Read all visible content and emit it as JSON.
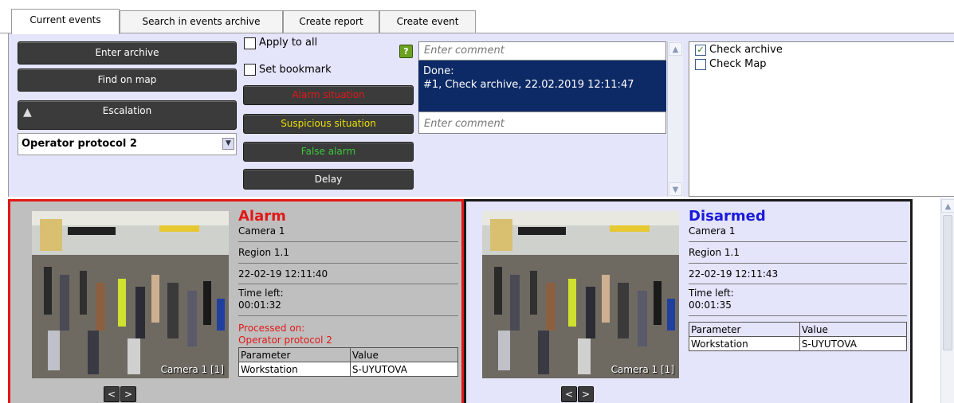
{
  "tabs": [
    {
      "label": "Current events",
      "active": true
    },
    {
      "label": "Search in events archive",
      "active": false
    },
    {
      "label": "Create report",
      "active": false
    },
    {
      "label": "Create event",
      "active": false
    }
  ],
  "controls": {
    "enter_archive": "Enter archive",
    "find_on_map": "Find on map",
    "escalation": "Escalation",
    "protocol_selected": "Operator protocol 2",
    "apply_to_all": "Apply to all",
    "set_bookmark": "Set bookmark",
    "help": "?",
    "alarm_situation": "Alarm situation",
    "suspicious_situation": "Suspicious situation",
    "false_alarm": "False alarm",
    "delay": "Delay"
  },
  "comments": {
    "top_placeholder": "Enter comment",
    "done_title": "Done:",
    "done_text": "#1, Check archive, 22.02.2019 12:11:47",
    "bottom_placeholder": "Enter comment"
  },
  "checklist": [
    {
      "label": "Check archive",
      "checked": true
    },
    {
      "label": "Check Map",
      "checked": false
    }
  ],
  "events": [
    {
      "status": "Alarm",
      "camera": "Camera 1",
      "region": "Region 1.1",
      "datetime": "22-02-19 12:11:40",
      "time_left_label": "Time left:",
      "time_left": "00:01:32",
      "processed_label": "Processed on:",
      "processed_value": "Operator protocol 2",
      "snapshot_label": "Camera 1 [1]",
      "table_header": [
        "Parameter",
        "Value"
      ],
      "table_row": [
        "Workstation",
        "S-UYUTOVA"
      ]
    },
    {
      "status": "Disarmed",
      "camera": "Camera 1",
      "region": "Region 1.1",
      "datetime": "22-02-19 12:11:43",
      "time_left_label": "Time left:",
      "time_left": "00:01:35",
      "snapshot_label": "Camera 1 [1]",
      "table_header": [
        "Parameter",
        "Value"
      ],
      "table_row": [
        "Workstation",
        "S-UYUTOVA"
      ]
    }
  ],
  "nav": {
    "prev": "<",
    "next": ">"
  },
  "colors": {
    "alarm_red": "#e11818",
    "disarmed_blue": "#1a1adc",
    "suspicious_yellow": "#e8e000",
    "false_alarm_green": "#3ec83e",
    "panel_bg": "#e4e4fa",
    "selected_blue": "#0d2a66"
  }
}
